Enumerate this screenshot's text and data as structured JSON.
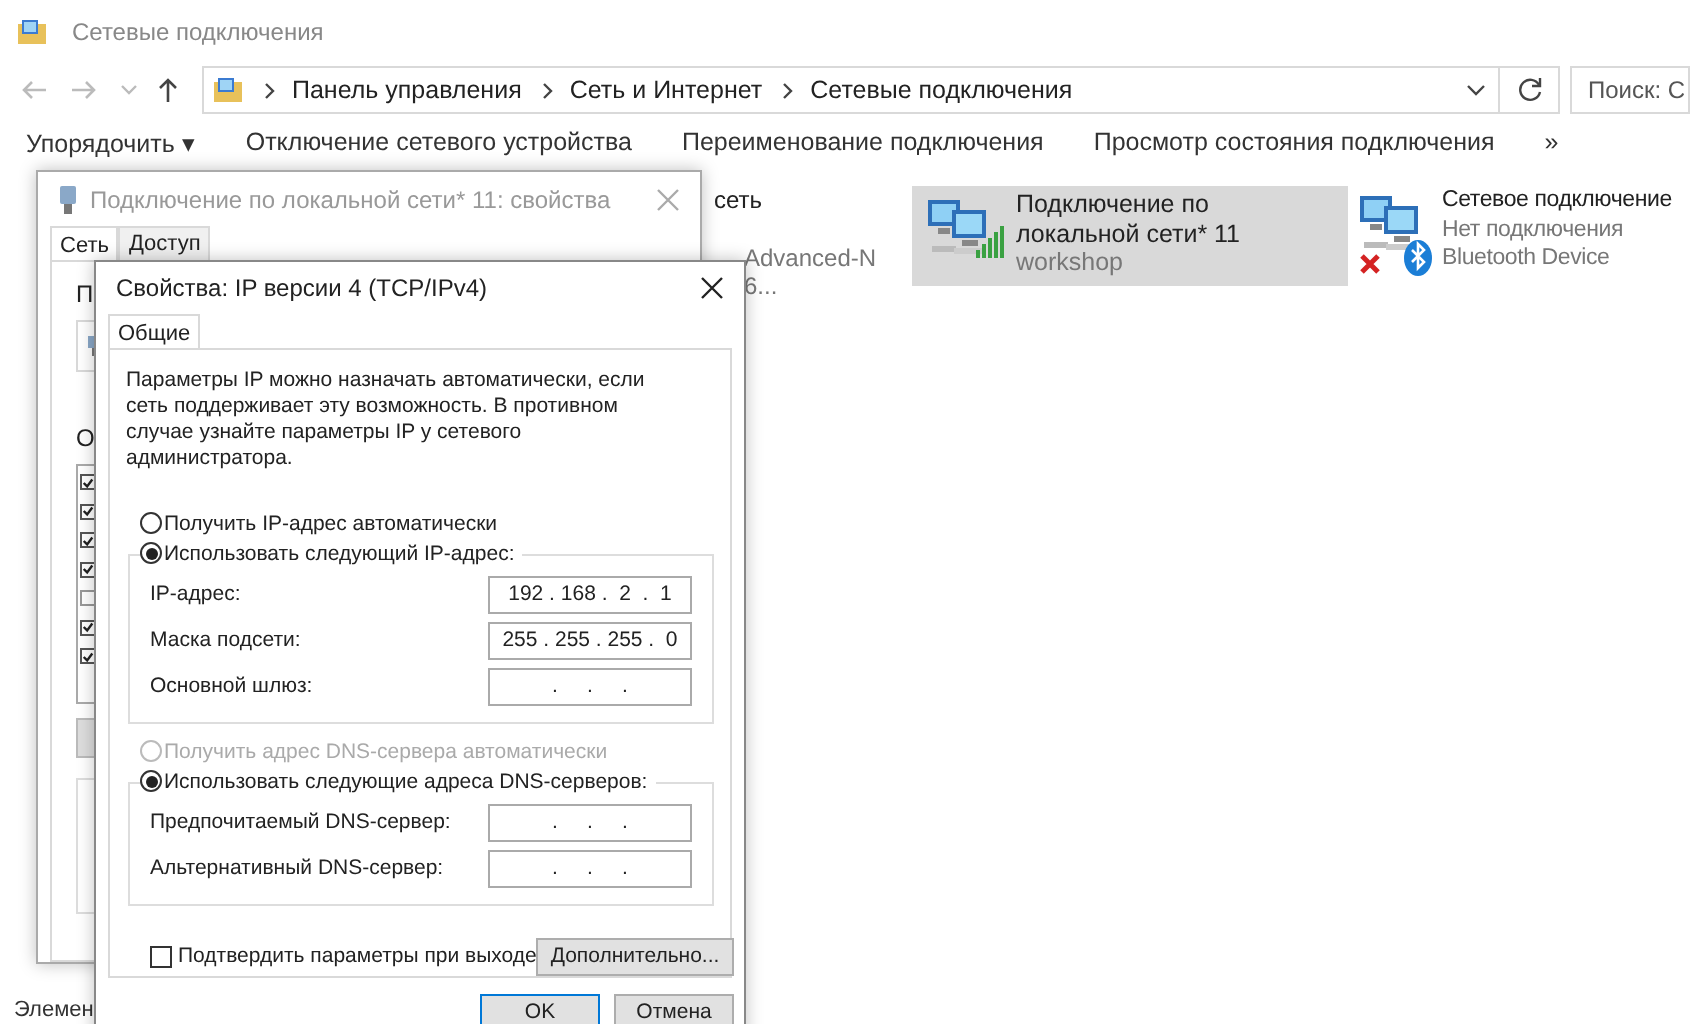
{
  "explorer": {
    "title": "Сетевые подключения",
    "breadcrumbs": [
      "Панель управления",
      "Сеть и Интернет",
      "Сетевые подключения"
    ],
    "search": {
      "placeholder": "Поиск: С"
    },
    "toolbar": [
      "Упорядочить ▾",
      "Отключение сетевого устройства",
      "Переименование подключения",
      "Просмотр состояния подключения",
      "»"
    ],
    "connections": [
      {
        "kind": "partial",
        "lines": [
          "сеть",
          "Advanced-N 6..."
        ],
        "selected": false
      },
      {
        "kind": "wifi",
        "name": "Подключение по локальной сети* 11",
        "status": "workshop",
        "selected": true
      },
      {
        "kind": "bluetooth",
        "name": "Сетевое подключение",
        "status": "Нет подключения",
        "device": "Bluetooth Device",
        "selected": false
      }
    ],
    "status_bar": "Элемен"
  },
  "properties": {
    "title": "Подключение по локальной сети* 11: свойства",
    "tabs": [
      {
        "label": "Сеть",
        "selected": true
      },
      {
        "label": "Доступ",
        "selected": false
      }
    ],
    "labels": [
      "П",
      "О"
    ],
    "components": [
      {
        "checked": true
      },
      {
        "checked": true
      },
      {
        "checked": true
      },
      {
        "checked": true
      },
      {
        "checked": false
      },
      {
        "checked": true
      },
      {
        "checked": true
      }
    ]
  },
  "ipv4": {
    "title": "Свойства: IP версии 4 (TCP/IPv4)",
    "tabs": [
      {
        "label": "Общие",
        "selected": true
      }
    ],
    "description": "Параметры IP можно назначать автоматически, если сеть поддерживает эту возможность. В противном случае узнайте параметры IP у сетевого администратора.",
    "ip_auto": {
      "label": "Получить IP-адрес автоматически",
      "selected": false,
      "disabled": false
    },
    "ip_manual": {
      "label": "Использовать следующий IP-адрес:",
      "selected": true,
      "disabled": false
    },
    "ip_fields": [
      {
        "label": "IP-адрес:",
        "value": "192 . 168 .  2  .  1"
      },
      {
        "label": "Маска подсети:",
        "value": "255 . 255 . 255 .  0"
      },
      {
        "label": "Основной шлюз:",
        "value": ".     .     ."
      }
    ],
    "dns_auto": {
      "label": "Получить адрес DNS-сервера автоматически",
      "selected": false,
      "disabled": true
    },
    "dns_manual": {
      "label": "Использовать следующие адреса DNS-серверов:",
      "selected": true,
      "disabled": false
    },
    "dns_fields": [
      {
        "label": "Предпочитаемый DNS-сервер:",
        "value": ".     .     ."
      },
      {
        "label": "Альтернативный DNS-сервер:",
        "value": ".     .     ."
      }
    ],
    "validate": {
      "label": "Подтвердить параметры при выходе",
      "checked": false
    },
    "advanced_button": "Дополнительно...",
    "buttons": [
      {
        "label": "OK",
        "default": true
      },
      {
        "label": "Отмена",
        "default": false
      }
    ]
  }
}
